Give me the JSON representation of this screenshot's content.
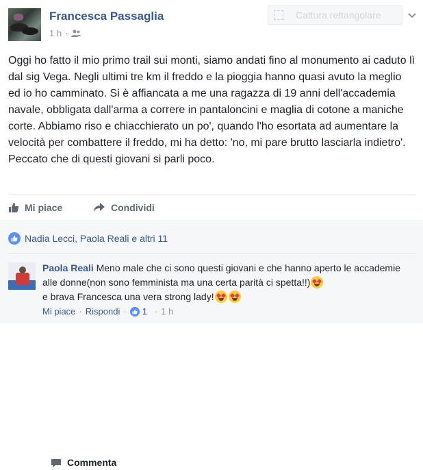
{
  "post": {
    "author": "Francesca Passaglia",
    "time": "1 h",
    "body": "Oggi ho fatto il mio primo trail sui monti, siamo andati fino al monumento ai caduto lì dal sig Vega. Negli ultimi tre km il freddo e la pioggia hanno quasi avuto la meglio ed io ho camminato. Si è affiancata a me una ragazza di 19 anni dell'accademia navale, obbligata dall'arma a correre in pantaloncini e maglia di cotone a maniche corte. Abbiamo riso e chiacchierato un po', quando l'ho esortata ad aumentare la velocità per combattere il freddo, mi ha detto: 'no, mi pare brutto lasciarla indietro'. Peccato che di questi giovani si parli poco."
  },
  "capture": {
    "label": "Cattura rettangolare"
  },
  "actions": {
    "like": "Mi piace",
    "comment": "Commenta",
    "share": "Condividi"
  },
  "reactions": {
    "text": "Nadia Lecci, Paola Reali e altri 11"
  },
  "comment": {
    "author": "Paola Reali",
    "text_1": "Meno male che ci sono questi giovani e che hanno aperto le accademie alle donne(non sono femminista ma una certa parità ci spetta!!)",
    "text_2": "e brava Francesca una vera strong lady!",
    "like_label": "Mi piace",
    "reply_label": "Rispondi",
    "like_count": "1",
    "time": "1 h"
  },
  "icons": {
    "audience": "friends-icon",
    "like": "thumbs-up-icon",
    "comment": "comment-bubble-icon",
    "share": "share-arrow-icon",
    "emoji": "heart-eyes-emoji-icon",
    "chevron": "chevron-down-icon"
  },
  "colors": {
    "link": "#365899",
    "meta": "#90949c",
    "like_badge": "#5890ff",
    "text": "#1d2129"
  }
}
